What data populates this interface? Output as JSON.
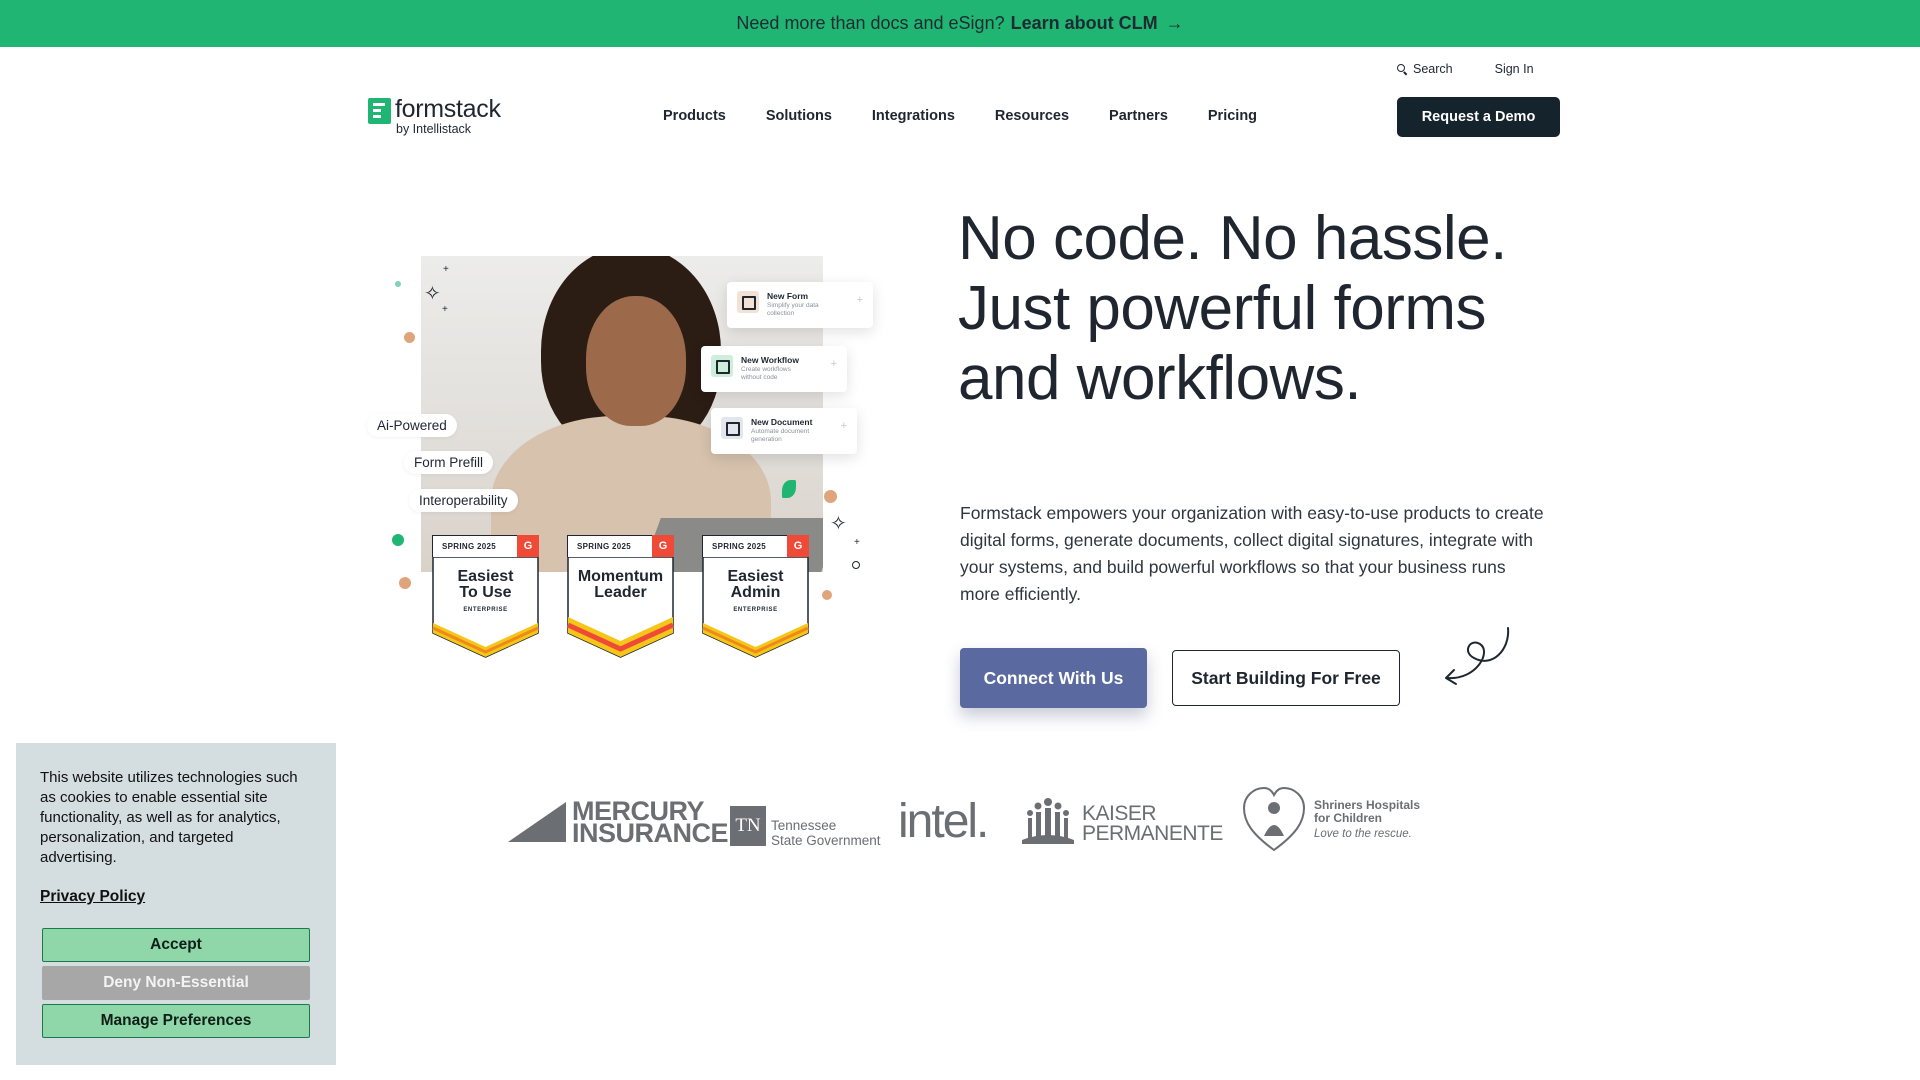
{
  "announcement": {
    "text": "Need more than docs and eSign?",
    "link_label": "Learn about CLM",
    "arrow_icon": "arrow-right-icon"
  },
  "utility": {
    "search_label": "Search",
    "signin_label": "Sign In"
  },
  "logo": {
    "word": "formstack",
    "sub": "by Intellistack"
  },
  "nav": {
    "items": [
      "Products",
      "Solutions",
      "Integrations",
      "Resources",
      "Partners",
      "Pricing"
    ]
  },
  "header": {
    "demo_label": "Request a Demo"
  },
  "hero": {
    "title_lines": [
      "No code. No hassle.",
      "Just powerful forms",
      "and workflows."
    ],
    "description": "Formstack empowers your organization with easy-to-use products to create digital forms, generate documents, collect digital signatures, integrate with your systems, and build powerful workflows so that your business runs more efficiently.",
    "primary_cta": "Connect With Us",
    "secondary_cta": "Start Building For Free"
  },
  "collage": {
    "cards": [
      {
        "title": "New Form",
        "subtitle": "Simplify your data collection"
      },
      {
        "title": "New Workflow",
        "subtitle": "Create workflows without code"
      },
      {
        "title": "New Document",
        "subtitle": "Automate document generation"
      }
    ],
    "pills": [
      "Ai-Powered",
      "Form Prefill",
      "Interoperability"
    ],
    "badges": [
      {
        "season": "SPRING 2025",
        "g2": "G",
        "label_1": "Easiest",
        "label_2": "To Use",
        "tier": "ENTERPRISE",
        "accent": "#f5c518"
      },
      {
        "season": "SPRING 2025",
        "g2": "G",
        "label_1": "Momentum",
        "label_2": "Leader",
        "tier": "",
        "accent": "#ef4a37"
      },
      {
        "season": "SPRING 2025",
        "g2": "G",
        "label_1": "Easiest",
        "label_2": "Admin",
        "tier": "ENTERPRISE",
        "accent": "#f5c518"
      }
    ]
  },
  "logos": {
    "mercury_1": "MERCURY",
    "mercury_2": "INSURANCE",
    "tn_mark": "TN",
    "tn_1": "Tennessee",
    "tn_2": "State Government",
    "intel": "intel.",
    "kaiser_1": "KAISER",
    "kaiser_2": "PERMANENTE",
    "shriners_1": "Shriners Hospitals",
    "shriners_2": "for Children",
    "shriners_tag": "Love to the rescue."
  },
  "cookie": {
    "message": "This website utilizes technologies such as cookies to enable essential site functionality, as well as for analytics, personalization, and targeted advertising.",
    "privacy_label": "Privacy Policy",
    "accept_label": "Accept",
    "deny_label": "Deny Non-Essential",
    "manage_label": "Manage Preferences"
  },
  "colors": {
    "brand_green": "#21b573",
    "primary_button": "#5a6aa1",
    "dark": "#15232d"
  }
}
